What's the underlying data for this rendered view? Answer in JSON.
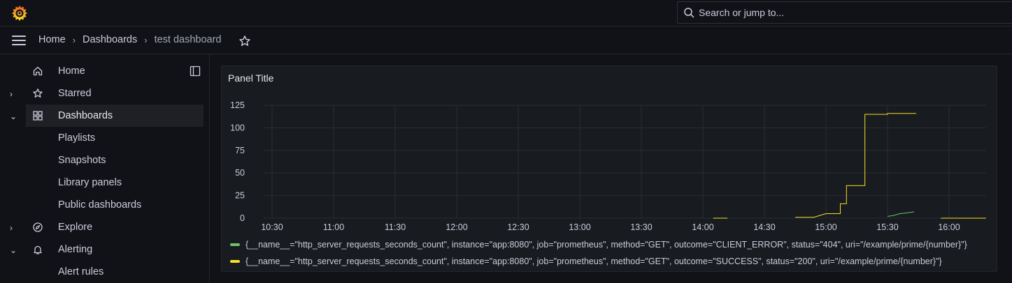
{
  "app": {
    "logo_icon": "grafana-logo-icon"
  },
  "search": {
    "placeholder": "Search or jump to..."
  },
  "breadcrumb": {
    "items": [
      "Home",
      "Dashboards",
      "test dashboard"
    ]
  },
  "sidebar": {
    "items": [
      {
        "label": "Home",
        "icon": "home-icon"
      },
      {
        "label": "Starred",
        "icon": "star-icon",
        "chevron": "›"
      },
      {
        "label": "Dashboards",
        "icon": "apps-icon",
        "chevron": "⌄"
      },
      {
        "label": "Playlists"
      },
      {
        "label": "Snapshots"
      },
      {
        "label": "Library panels"
      },
      {
        "label": "Public dashboards"
      },
      {
        "label": "Explore",
        "icon": "compass-icon",
        "chevron": "›"
      },
      {
        "label": "Alerting",
        "icon": "bell-icon",
        "chevron": "⌄"
      },
      {
        "label": "Alert rules"
      }
    ]
  },
  "panel": {
    "title": "Panel Title"
  },
  "colors": {
    "accent": "#f55f3e",
    "series_green": "#73bf69",
    "series_yellow": "#fade2a"
  },
  "chart_data": {
    "type": "line",
    "ylim": [
      0,
      125
    ],
    "yticks": [
      "0",
      "25",
      "50",
      "75",
      "100",
      "125"
    ],
    "xticks": [
      "10:30",
      "11:00",
      "11:30",
      "12:00",
      "12:30",
      "13:00",
      "13:30",
      "14:00",
      "14:30",
      "15:00",
      "15:30",
      "16:00"
    ],
    "grid": true,
    "legend_position": "bottom",
    "series": [
      {
        "name": "{__name__=\"http_server_requests_seconds_count\", instance=\"app:8080\", job=\"prometheus\", method=\"GET\", outcome=\"CLIENT_ERROR\", status=\"404\", uri=\"/example/prime/{number}\"}",
        "color": "#73bf69",
        "points": [
          [
            "15:30",
            2
          ],
          [
            "15:33",
            3
          ],
          [
            "15:36",
            5
          ],
          [
            "15:40",
            6
          ],
          [
            "15:43",
            7
          ]
        ]
      },
      {
        "name": "{__name__=\"http_server_requests_seconds_count\", instance=\"app:8080\", job=\"prometheus\", method=\"GET\", outcome=\"SUCCESS\", status=\"200\", uri=\"/example/prime/{number}\"}",
        "color": "#fade2a",
        "segments": [
          [
            [
              "14:05",
              0
            ],
            [
              "14:12",
              0
            ]
          ],
          [
            [
              "14:45",
              1
            ],
            [
              "14:54",
              1
            ],
            [
              "14:57",
              3
            ],
            [
              "15:00",
              5
            ],
            [
              "15:07",
              5
            ],
            [
              "15:07",
              16
            ],
            [
              "15:10",
              16
            ],
            [
              "15:10",
              36
            ],
            [
              "15:19",
              36
            ],
            [
              "15:19",
              115
            ],
            [
              "15:30",
              115
            ],
            [
              "15:30",
              116
            ],
            [
              "15:44",
              116
            ]
          ],
          [
            [
              "15:56",
              0
            ],
            [
              "16:18",
              0
            ]
          ]
        ]
      }
    ]
  }
}
